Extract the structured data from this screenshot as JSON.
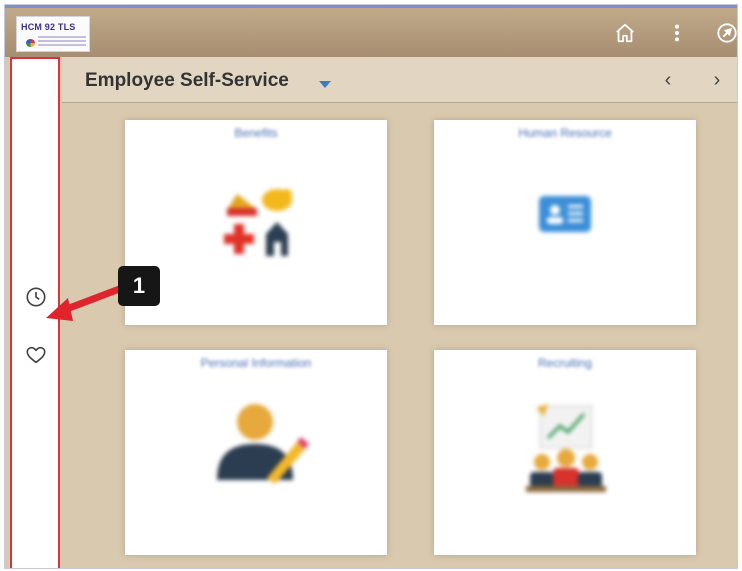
{
  "brand": {
    "logo_text": "HCM 92 TLS",
    "logo_subtitle": "San Diego Unified"
  },
  "header": {
    "title": "Employee Self-Service"
  },
  "topbar_icons": [
    "home-icon",
    "more-vert-icon",
    "navbar-icon"
  ],
  "sidebar_icons": [
    "recently-visited-clock-icon",
    "favorites-heart-icon"
  ],
  "tiles": [
    {
      "title": "Benefits",
      "icon": "benefits-icon"
    },
    {
      "title": "Human Resource",
      "icon": "id-card-icon"
    },
    {
      "title": "Personal Information",
      "icon": "person-edit-icon"
    },
    {
      "title": "Recruiting",
      "icon": "recruiting-icon"
    }
  ],
  "annotation": {
    "callout_number": "1"
  },
  "colors": {
    "highlight_border": "#d9333f",
    "topbar": "#b09878",
    "page_bg": "#d9c9ae",
    "arrow": "#e0242c"
  }
}
